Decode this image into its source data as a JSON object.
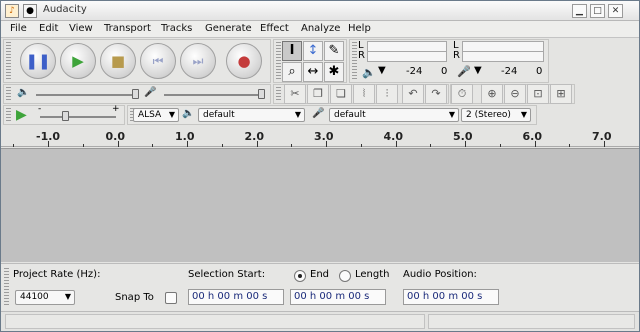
{
  "window": {
    "title": "Audacity",
    "buttons": [
      "▁",
      "□",
      "✕"
    ]
  },
  "menu": [
    "File",
    "Edit",
    "View",
    "Transport",
    "Tracks",
    "Generate",
    "Effect",
    "Analyze",
    "Help"
  ],
  "transport": {
    "icons": [
      "pause-icon",
      "play-icon",
      "stop-icon",
      "skip-to-start-icon",
      "skip-to-end-icon",
      "record-icon"
    ],
    "colors": {
      "play": "#3ea43a",
      "pause": "#3d5fc8",
      "stop": "#b79a4d",
      "record": "#c43c3c"
    }
  },
  "tools": [
    "I",
    "↕",
    "✎",
    "🔍",
    "↔",
    "✱"
  ],
  "meters": {
    "left_letter": "L",
    "right_letter": "R",
    "playback_ticks": [
      "-24",
      "0"
    ],
    "record_ticks": [
      "-24",
      "0"
    ]
  },
  "mixer": {
    "volume_icon": "speaker-icon",
    "mic_icon": "microphone-icon"
  },
  "edit_toolbar_icons": [
    "cut-icon",
    "copy-icon",
    "paste-icon",
    "trim-icon",
    "silence-icon",
    "undo-icon",
    "redo-icon",
    "sync-lock-icon",
    "zoom-in-icon",
    "zoom-out-icon",
    "fit-selection-icon",
    "fit-project-icon"
  ],
  "device": {
    "host": "ALSA",
    "output": "default",
    "input": "default",
    "channels": "2 (Stereo)"
  },
  "ruler": {
    "labels": [
      "-1.0",
      "0.0",
      "1.0",
      "2.0",
      "3.0",
      "4.0",
      "5.0",
      "6.0",
      "7.0"
    ]
  },
  "selection": {
    "project_rate_label": "Project Rate (Hz):",
    "project_rate_value": "44100",
    "snap_to_label": "Snap To",
    "selection_start_label": "Selection Start:",
    "end_label": "End",
    "length_label": "Length",
    "audio_position_label": "Audio Position:",
    "start_time": "00 h 00 m 00 s",
    "end_time": "00 h 00 m 00 s",
    "position_time": "00 h 00 m 00 s"
  }
}
